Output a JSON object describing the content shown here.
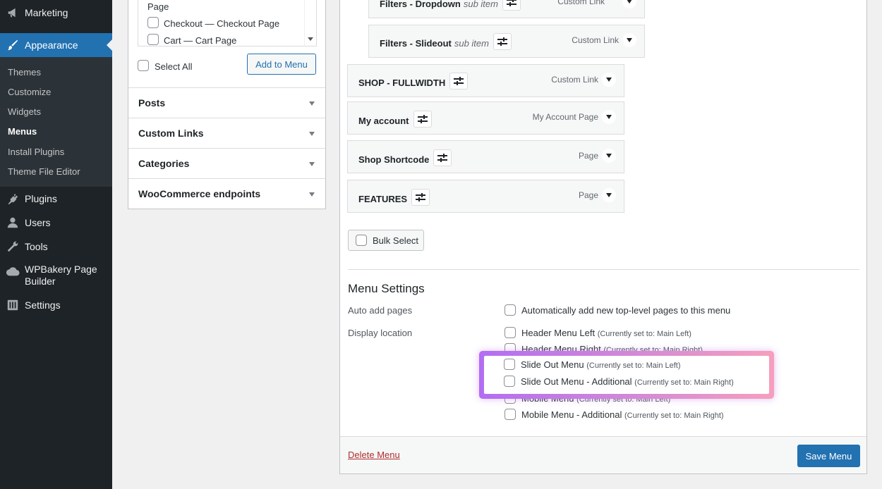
{
  "sidebar": {
    "marketing": "Marketing",
    "appearance": "Appearance",
    "submenu": [
      "Themes",
      "Customize",
      "Widgets",
      "Menus",
      "Install Plugins",
      "Theme File Editor"
    ],
    "plugins": "Plugins",
    "users": "Users",
    "tools": "Tools",
    "wpbakery": "WPBakery Page Builder",
    "settings": "Settings"
  },
  "left_panel": {
    "checklist": {
      "partial": "Page",
      "items": [
        {
          "pre": "Checkout — ",
          "strong": "Checkout Page"
        },
        {
          "pre": "Cart — ",
          "strong": "Cart Page"
        }
      ]
    },
    "select_all": "Select All",
    "add_to_menu": "Add to Menu",
    "sections": [
      "Posts",
      "Custom Links",
      "Categories",
      "WooCommerce endpoints"
    ]
  },
  "menu_items": [
    {
      "title": "Filters - Dropdown",
      "sub": "sub item",
      "type": "Custom Link"
    },
    {
      "title": "Filters - Slideout",
      "sub": "sub item",
      "type": "Custom Link"
    },
    {
      "title": "SHOP - FULLWIDTH",
      "sub": "",
      "type": "Custom Link"
    },
    {
      "title": "My account",
      "sub": "",
      "type": "My Account Page"
    },
    {
      "title": "Shop Shortcode",
      "sub": "",
      "type": "Page"
    },
    {
      "title": "FEATURES",
      "sub": "",
      "type": "Page"
    }
  ],
  "bulk_select": "Bulk Select",
  "menu_settings": {
    "title": "Menu Settings",
    "auto_add_label": "Auto add pages",
    "auto_add_option": "Automatically add new top-level pages to this menu",
    "display_location_label": "Display location",
    "locations": [
      {
        "name": "Header Menu Left",
        "note": "(Currently set to: Main Left)"
      },
      {
        "name": "Header Menu Right",
        "note": "(Currently set to: Main Right)"
      },
      {
        "name": "Slide Out Menu",
        "note": "(Currently set to: Main Left)"
      },
      {
        "name": "Slide Out Menu - Additional",
        "note": "(Currently set to: Main Right)"
      },
      {
        "name": "Mobile Menu",
        "note": "(Currently set to: Main Left)"
      },
      {
        "name": "Mobile Menu - Additional",
        "note": "(Currently set to: Main Right)"
      }
    ]
  },
  "footer": {
    "delete_menu": "Delete Menu",
    "save_menu": "Save Menu"
  },
  "colors": {
    "admin_bar": "#1d2327",
    "accent": "#2271b1",
    "delete": "#b32d2e",
    "highlight_start": "#b26df3",
    "highlight_end": "#f69fbd"
  }
}
